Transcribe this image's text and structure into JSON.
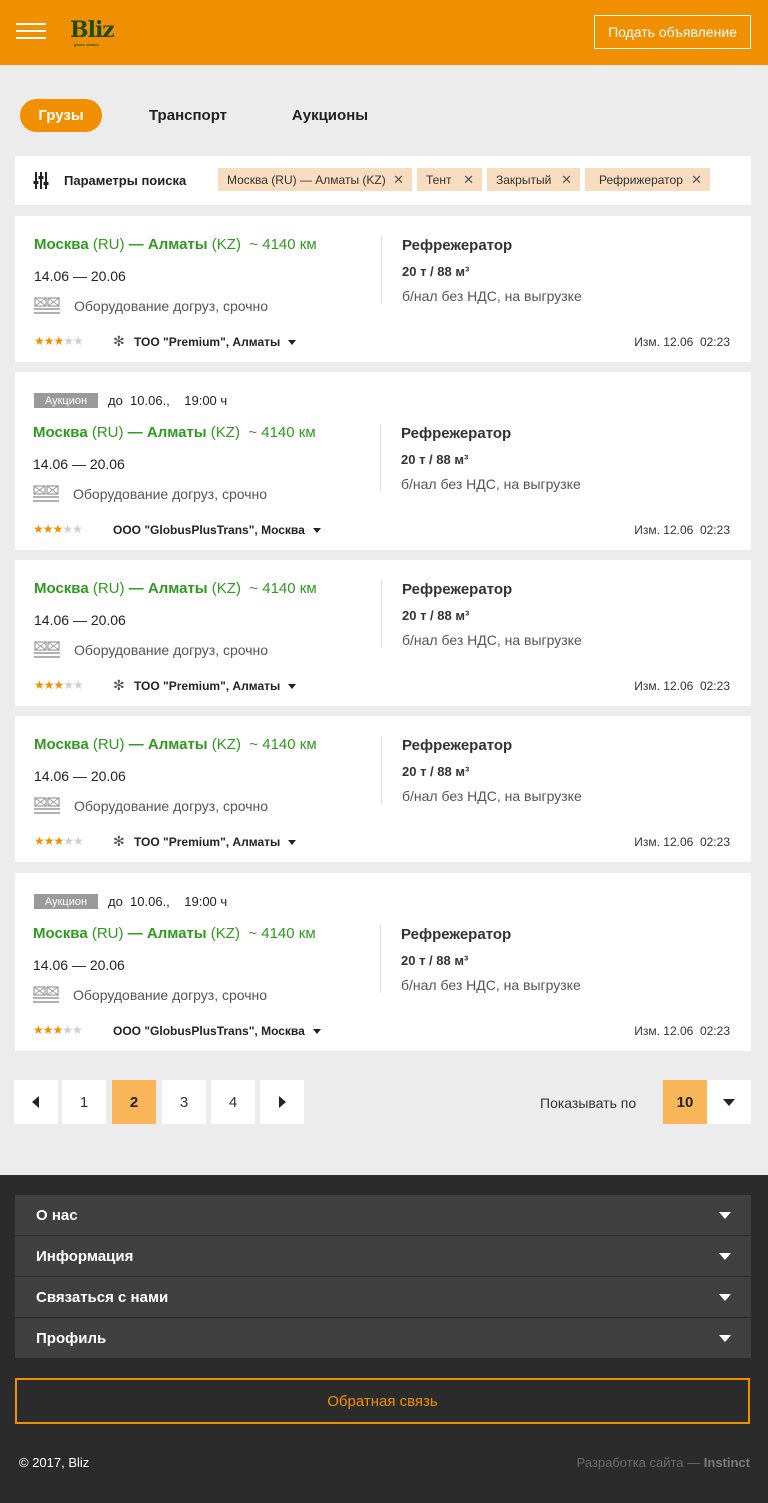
{
  "header": {
    "logo": "Bliz",
    "logo_sub": "green choice",
    "post_button": "Подать объявление",
    "brand_color": "#f09000"
  },
  "tabs": [
    {
      "label": "Грузы",
      "active": true
    },
    {
      "label": "Транспорт",
      "active": false
    },
    {
      "label": "Аукционы",
      "active": false
    }
  ],
  "filters": {
    "label": "Параметры поиска",
    "chips": [
      "Москва (RU) — Алматы (KZ)",
      "Тент",
      "Закрытый",
      "Рефрижератор"
    ]
  },
  "listings": [
    {
      "auction": false,
      "from_city": "Москва",
      "from_cc": "(RU)",
      "dash": " — ",
      "to_city": "Алматы",
      "to_cc": "(KZ)",
      "distance": "~ 4140 км",
      "dates": "14.06 — 20.06",
      "equipment": "Оборудование догруз, срочно",
      "vehicle_type": "Рефрежератор",
      "weight": "20 т / 88 м³",
      "payment": "б/нал без НДС, на выгрузке",
      "rating": 3,
      "rating_max": 5,
      "verified_mark": "✻",
      "company": "ТОО \"Premium\", Алматы",
      "modified": "Изм. 12.06  02:23"
    },
    {
      "auction": true,
      "auction_label": "Аукцион",
      "deadline": "до  10.06.,    19:00 ч",
      "from_city": "Москва",
      "from_cc": "(RU)",
      "dash": " — ",
      "to_city": "Алматы",
      "to_cc": "(KZ)",
      "distance": "~ 4140 км",
      "dates": "14.06 — 20.06",
      "equipment": "Оборудование догруз, срочно",
      "vehicle_type": "Рефрежератор",
      "weight": "20 т / 88 м³",
      "payment": "б/нал без НДС, на выгрузке",
      "rating": 3,
      "rating_max": 5,
      "company": "ООО \"GlobusPlusTrans\", Москва",
      "modified": "Изм. 12.06  02:23"
    },
    {
      "auction": false,
      "from_city": "Москва",
      "from_cc": "(RU)",
      "dash": " — ",
      "to_city": "Алматы",
      "to_cc": "(KZ)",
      "distance": "~ 4140 км",
      "dates": "14.06 — 20.06",
      "equipment": "Оборудование догруз, срочно",
      "vehicle_type": "Рефрежератор",
      "weight": "20 т / 88 м³",
      "payment": "б/нал без НДС, на выгрузке",
      "rating": 3,
      "rating_max": 5,
      "verified_mark": "✻",
      "company": "ТОО \"Premium\", Алматы",
      "modified": "Изм. 12.06  02:23"
    },
    {
      "auction": false,
      "from_city": "Москва",
      "from_cc": "(RU)",
      "dash": " — ",
      "to_city": "Алматы",
      "to_cc": "(KZ)",
      "distance": "~ 4140 км",
      "dates": "14.06 — 20.06",
      "equipment": "Оборудование догруз, срочно",
      "vehicle_type": "Рефрежератор",
      "weight": "20 т / 88 м³",
      "payment": "б/нал без НДС, на выгрузке",
      "rating": 3,
      "rating_max": 5,
      "verified_mark": "✻",
      "company": "ТОО \"Premium\", Алматы",
      "modified": "Изм. 12.06  02:23"
    },
    {
      "auction": true,
      "auction_label": "Аукцион",
      "deadline": "до  10.06.,    19:00 ч",
      "from_city": "Москва",
      "from_cc": "(RU)",
      "dash": " — ",
      "to_city": "Алматы",
      "to_cc": "(KZ)",
      "distance": "~ 4140 км",
      "dates": "14.06 — 20.06",
      "equipment": "Оборудование догруз, срочно",
      "vehicle_type": "Рефрежератор",
      "weight": "20 т / 88 м³",
      "payment": "б/нал без НДС, на выгрузке",
      "rating": 3,
      "rating_max": 5,
      "company": "ООО \"GlobusPlusTrans\", Москва",
      "modified": "Изм. 12.06  02:23"
    }
  ],
  "pagination": {
    "pages": [
      "1",
      "2",
      "3",
      "4"
    ],
    "current": "2",
    "per_page_label": "Показывать по",
    "per_page_value": "10"
  },
  "footer": {
    "sections": [
      "О нас",
      "Информация",
      "Связаться с нами",
      "Профиль"
    ],
    "feedback_button": "Обратная связь",
    "copyright": "© 2017, Bliz",
    "developer_prefix": "Разработка сайта — ",
    "developer_name": "Instinct"
  }
}
